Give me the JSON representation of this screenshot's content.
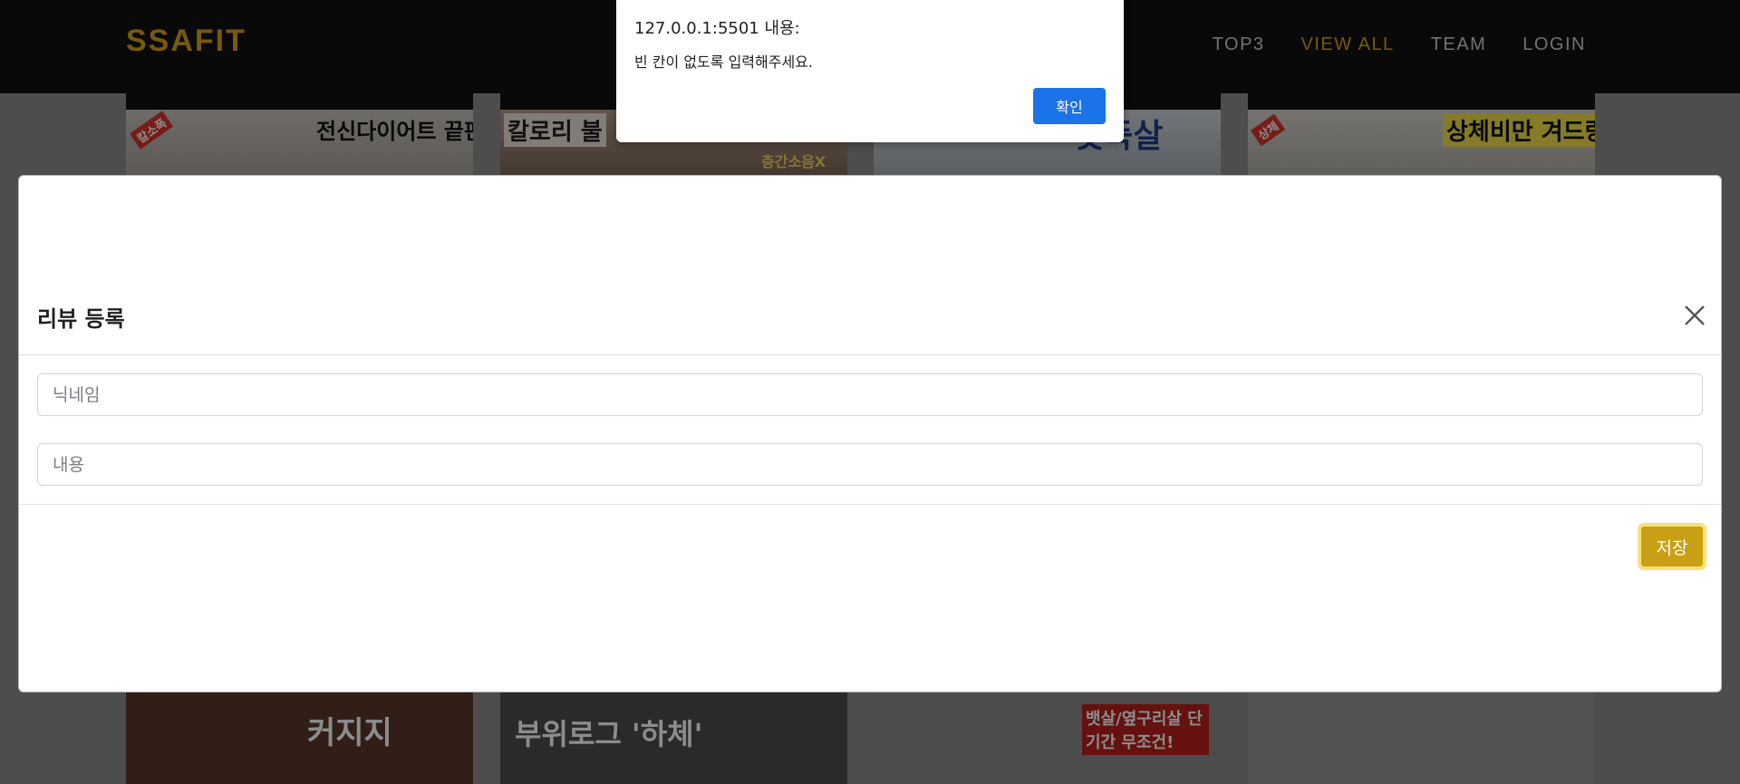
{
  "navbar": {
    "brand": "SSAFIT",
    "links": [
      {
        "label": "TOP3",
        "active": false
      },
      {
        "label": "VIEW ALL",
        "active": true
      },
      {
        "label": "TEAM",
        "active": false
      },
      {
        "label": "LOGIN",
        "active": false
      }
    ]
  },
  "background_thumbnails": {
    "top": [
      {
        "caption": "전신다이어트 끝판왕운동",
        "badge": "칼소폭"
      },
      {
        "caption": "칼로리 불",
        "subcaption": "층간소음X"
      },
      {
        "caption": "뱃뚝살"
      },
      {
        "caption": "상체비만 겨드랑이살",
        "badge": "상체"
      }
    ],
    "bottom": [
      {
        "caption": "커지지"
      },
      {
        "caption": "부위로그 '하체'"
      },
      {
        "caption": "뱃살/옆구리살 단기간 무조건!"
      },
      {
        "caption": ""
      }
    ]
  },
  "modal": {
    "title": "리뷰 등록",
    "nickname_placeholder": "닉네임",
    "content_placeholder": "내용",
    "save_label": "저장"
  },
  "alert": {
    "origin": "127.0.0.1:5501 내용:",
    "message": "빈 칸이 없도록 입력해주세요.",
    "ok_label": "확인"
  },
  "colors": {
    "brand": "#d8a316",
    "save_button": "#c9a015",
    "alert_ok": "#1a73e8"
  }
}
